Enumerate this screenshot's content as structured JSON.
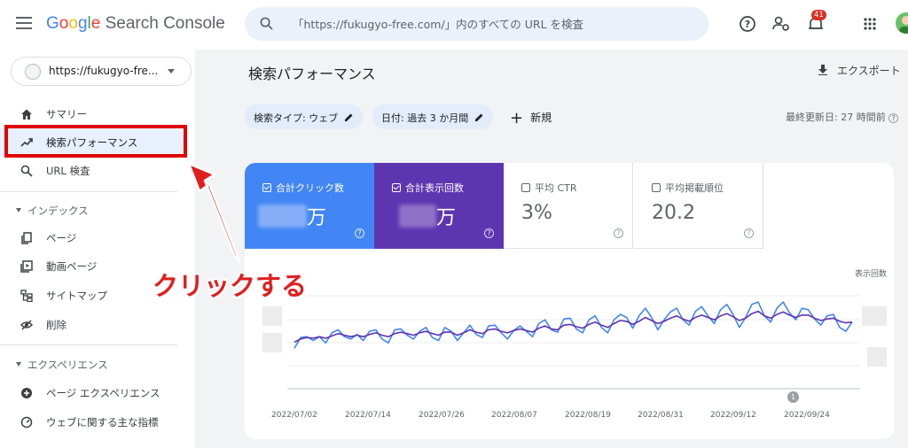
{
  "header": {
    "app_title_parts": [
      "G",
      "o",
      "o",
      "g",
      "l",
      "e"
    ],
    "app_title_rest": " Search Console",
    "search_placeholder": "「https://fukugyo-free.com/」内のすべての URL を検査",
    "notification_count": "41",
    "icons": [
      "menu-icon",
      "search-icon",
      "help-icon",
      "users-settings-icon",
      "notifications-icon",
      "apps-icon",
      "account-avatar"
    ]
  },
  "sidebar": {
    "property": "https://fukugyo-fre...",
    "items": [
      {
        "label": "サマリー",
        "icon": "home-icon"
      },
      {
        "label": "検索パフォーマンス",
        "icon": "trending-up-icon"
      },
      {
        "label": "URL 検査",
        "icon": "search-icon"
      }
    ],
    "section_index": "インデックス",
    "index_items": [
      {
        "label": "ページ",
        "icon": "pages-icon"
      },
      {
        "label": "動画ページ",
        "icon": "video-pages-icon"
      },
      {
        "label": "サイトマップ",
        "icon": "sitemap-icon"
      },
      {
        "label": "削除",
        "icon": "removals-icon"
      }
    ],
    "section_experience": "エクスペリエンス",
    "experience_items": [
      {
        "label": "ページ エクスペリエンス",
        "icon": "page-experience-icon"
      },
      {
        "label": "ウェブに関する主な指標",
        "icon": "core-web-vitals-icon"
      }
    ]
  },
  "main": {
    "title": "検索パフォーマンス",
    "export_label": "エクスポート",
    "filters": [
      "検索タイプ: ウェブ",
      "日付: 過去 3 か月間"
    ],
    "new_label": "新規",
    "last_updated": "最終更新日: 27 時間前"
  },
  "metrics": [
    {
      "label": "合計クリック数",
      "value": "万",
      "checked": true,
      "color": "#4285f4"
    },
    {
      "label": "合計表示回数",
      "value": "万",
      "checked": true,
      "color": "#5e35b1"
    },
    {
      "label": "平均 CTR",
      "value": "3%",
      "checked": false,
      "color": "#ffffff"
    },
    {
      "label": "平均掲載順位",
      "value": "20.2",
      "checked": false,
      "color": "#ffffff"
    }
  ],
  "chart_data": {
    "type": "line",
    "ylabel_right": "表示回数",
    "x_ticks": [
      "2022/07/02",
      "2022/07/14",
      "2022/07/26",
      "2022/08/07",
      "2022/08/19",
      "2022/08/31",
      "2022/09/12",
      "2022/09/24"
    ],
    "annotation": "1",
    "series": [
      {
        "color": "#4285f4",
        "values": [
          0.18,
          0.32,
          0.33,
          0.28,
          0.33,
          0.25,
          0.38,
          0.42,
          0.33,
          0.3,
          0.36,
          0.28,
          0.4,
          0.42,
          0.3,
          0.25,
          0.42,
          0.43,
          0.35,
          0.3,
          0.4,
          0.45,
          0.32,
          0.28,
          0.45,
          0.4,
          0.28,
          0.38,
          0.48,
          0.36,
          0.32,
          0.47,
          0.48,
          0.38,
          0.3,
          0.41,
          0.47,
          0.4,
          0.33,
          0.5,
          0.55,
          0.42,
          0.39,
          0.56,
          0.57,
          0.43,
          0.38,
          0.55,
          0.6,
          0.45,
          0.38,
          0.55,
          0.62,
          0.58,
          0.44,
          0.6,
          0.7,
          0.58,
          0.42,
          0.55,
          0.65,
          0.7,
          0.55,
          0.48,
          0.66,
          0.72,
          0.6,
          0.5,
          0.68,
          0.75,
          0.62,
          0.45,
          0.58,
          0.75,
          0.78,
          0.6,
          0.52,
          0.7,
          0.78,
          0.64,
          0.55,
          0.7,
          0.68,
          0.56,
          0.48,
          0.6,
          0.62,
          0.45,
          0.4,
          0.52
        ]
      },
      {
        "color": "#5e35b1",
        "values": [
          0.26,
          0.3,
          0.32,
          0.31,
          0.33,
          0.31,
          0.34,
          0.37,
          0.35,
          0.33,
          0.35,
          0.33,
          0.36,
          0.38,
          0.35,
          0.33,
          0.37,
          0.39,
          0.37,
          0.35,
          0.38,
          0.4,
          0.37,
          0.35,
          0.39,
          0.39,
          0.35,
          0.38,
          0.42,
          0.39,
          0.37,
          0.42,
          0.43,
          0.4,
          0.38,
          0.41,
          0.43,
          0.41,
          0.39,
          0.44,
          0.47,
          0.43,
          0.42,
          0.48,
          0.49,
          0.46,
          0.44,
          0.49,
          0.52,
          0.48,
          0.45,
          0.5,
          0.54,
          0.53,
          0.49,
          0.53,
          0.58,
          0.54,
          0.5,
          0.53,
          0.57,
          0.6,
          0.56,
          0.53,
          0.58,
          0.61,
          0.58,
          0.55,
          0.6,
          0.63,
          0.59,
          0.54,
          0.57,
          0.63,
          0.66,
          0.6,
          0.57,
          0.62,
          0.65,
          0.61,
          0.58,
          0.61,
          0.61,
          0.57,
          0.54,
          0.56,
          0.57,
          0.53,
          0.51,
          0.52
        ]
      }
    ]
  },
  "callout_text": "クリックする"
}
